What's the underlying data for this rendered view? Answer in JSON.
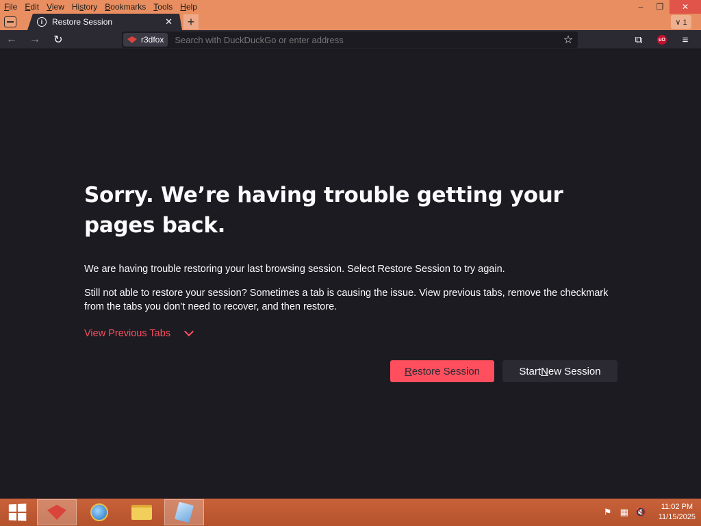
{
  "menu": [
    {
      "mnemonic": "F",
      "rest": "ile"
    },
    {
      "mnemonic": "E",
      "rest": "dit"
    },
    {
      "mnemonic": "V",
      "rest": "iew"
    },
    {
      "pre": "Hi",
      "mnemonic": "s",
      "rest": "tory"
    },
    {
      "mnemonic": "B",
      "rest": "ookmarks"
    },
    {
      "mnemonic": "T",
      "rest": "ools"
    },
    {
      "mnemonic": "H",
      "rest": "elp"
    }
  ],
  "window_controls": {
    "minimize": "–",
    "restore": "❐",
    "close": "✕"
  },
  "tab": {
    "title": "Restore Session",
    "icon": "info-icon",
    "close": "✕"
  },
  "new_tab": "+",
  "tab_list": "∨ 1",
  "nav": {
    "back": "←",
    "forward": "→",
    "reload": "↻",
    "identity_label": "r3dfox",
    "url_placeholder": "Search with DuckDuckGo or enter address",
    "bookmark_star": "☆",
    "extensions": "⧉",
    "ublock": "uO",
    "menu": "≡"
  },
  "content": {
    "heading": "Sorry. We’re having trouble getting your pages back.",
    "para1": "We are having trouble restoring your last browsing session. Select Restore Session to try again.",
    "para2": "Still not able to restore your session? Sometimes a tab is causing the issue. View previous tabs, remove the checkmark from the tabs you don’t need to recover, and then restore.",
    "view_previous": "View Previous Tabs",
    "restore_button": {
      "mnemonic": "R",
      "rest": "estore Session"
    },
    "new_session_button": {
      "pre": "Start ",
      "mnemonic": "N",
      "rest": "ew Session"
    }
  },
  "taskbar": {
    "apps": [
      "r3dfox",
      "internet-explorer",
      "file-explorer",
      "document"
    ],
    "tray_icons": [
      "flag-icon",
      "network-icon",
      "volume-muted-icon"
    ],
    "time": "11:02 PM",
    "date": "11/15/2025"
  },
  "colors": {
    "accent": "#ff4f5e",
    "background": "#1c1b22",
    "titlebar": "#e88e60",
    "taskbar": "#c9623a"
  }
}
